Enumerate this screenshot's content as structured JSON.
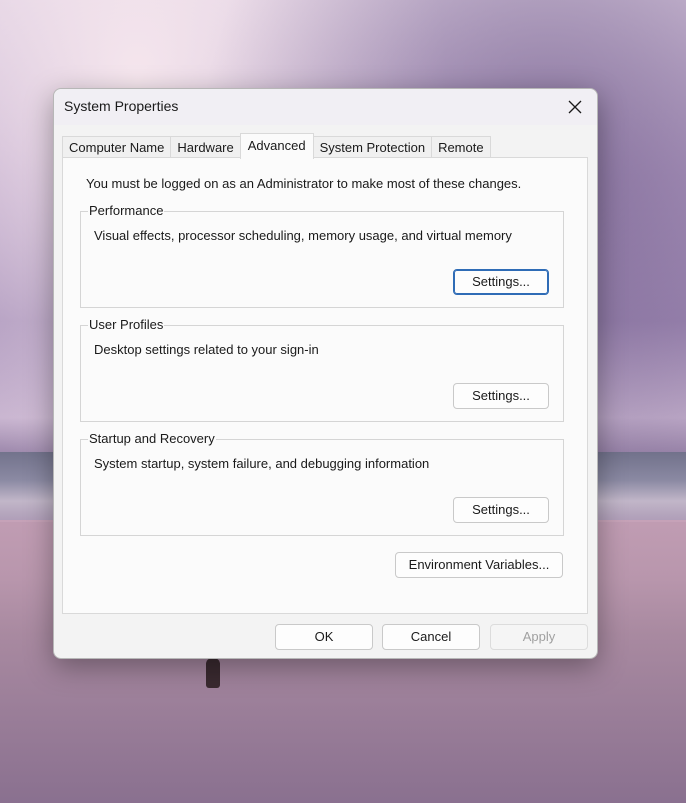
{
  "window": {
    "title": "System Properties",
    "close_icon": "close-icon"
  },
  "tabs": [
    {
      "label": "Computer Name",
      "active": false
    },
    {
      "label": "Hardware",
      "active": false
    },
    {
      "label": "Advanced",
      "active": true
    },
    {
      "label": "System Protection",
      "active": false
    },
    {
      "label": "Remote",
      "active": false
    }
  ],
  "advanced": {
    "admin_note": "You must be logged on as an Administrator to make most of these changes.",
    "groups": [
      {
        "label": "Performance",
        "description": "Visual effects, processor scheduling, memory usage, and virtual memory",
        "button": "Settings..."
      },
      {
        "label": "User Profiles",
        "description": "Desktop settings related to your sign-in",
        "button": "Settings..."
      },
      {
        "label": "Startup and Recovery",
        "description": "System startup, system failure, and debugging information",
        "button": "Settings..."
      }
    ],
    "env_button": "Environment Variables..."
  },
  "footer": {
    "ok": "OK",
    "cancel": "Cancel",
    "apply": "Apply"
  },
  "colors": {
    "focus_accent": "#2f6cb6"
  }
}
